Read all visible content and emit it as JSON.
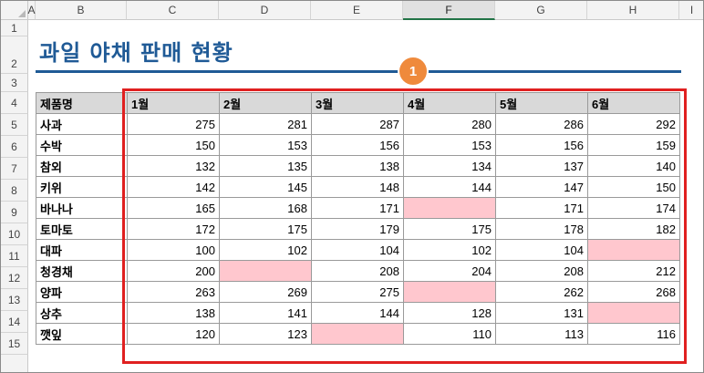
{
  "columns": [
    "A",
    "B",
    "C",
    "D",
    "E",
    "F",
    "G",
    "H",
    "I"
  ],
  "rows": [
    "1",
    "2",
    "3",
    "4",
    "5",
    "6",
    "7",
    "8",
    "9",
    "10",
    "11",
    "12",
    "13",
    "14",
    "15"
  ],
  "title": "과일 야채 판매 현황",
  "badge": "1",
  "colors": {
    "title": "#1f5a96",
    "highlight": "#ffc7ce",
    "box": "#e02020",
    "badge": "#ef8a3c"
  },
  "table": {
    "header": [
      "제품명",
      "1월",
      "2월",
      "3월",
      "4월",
      "5월",
      "6월"
    ],
    "rows": [
      {
        "name": "사과",
        "values": [
          "275",
          "281",
          "287",
          "280",
          "286",
          "292"
        ]
      },
      {
        "name": "수박",
        "values": [
          "150",
          "153",
          "156",
          "153",
          "156",
          "159"
        ]
      },
      {
        "name": "참외",
        "values": [
          "132",
          "135",
          "138",
          "134",
          "137",
          "140"
        ]
      },
      {
        "name": "키위",
        "values": [
          "142",
          "145",
          "148",
          "144",
          "147",
          "150"
        ]
      },
      {
        "name": "바나나",
        "values": [
          "165",
          "168",
          "171",
          "",
          "171",
          "174"
        ]
      },
      {
        "name": "토마토",
        "values": [
          "172",
          "175",
          "179",
          "175",
          "178",
          "182"
        ]
      },
      {
        "name": "대파",
        "values": [
          "100",
          "102",
          "104",
          "102",
          "104",
          ""
        ]
      },
      {
        "name": "청경채",
        "values": [
          "200",
          "",
          "208",
          "204",
          "208",
          "212"
        ]
      },
      {
        "name": "양파",
        "values": [
          "263",
          "269",
          "275",
          "",
          "262",
          "268"
        ]
      },
      {
        "name": "상추",
        "values": [
          "138",
          "141",
          "144",
          "128",
          "131",
          ""
        ]
      },
      {
        "name": "깻잎",
        "values": [
          "120",
          "123",
          "",
          "110",
          "113",
          "116"
        ]
      }
    ]
  }
}
